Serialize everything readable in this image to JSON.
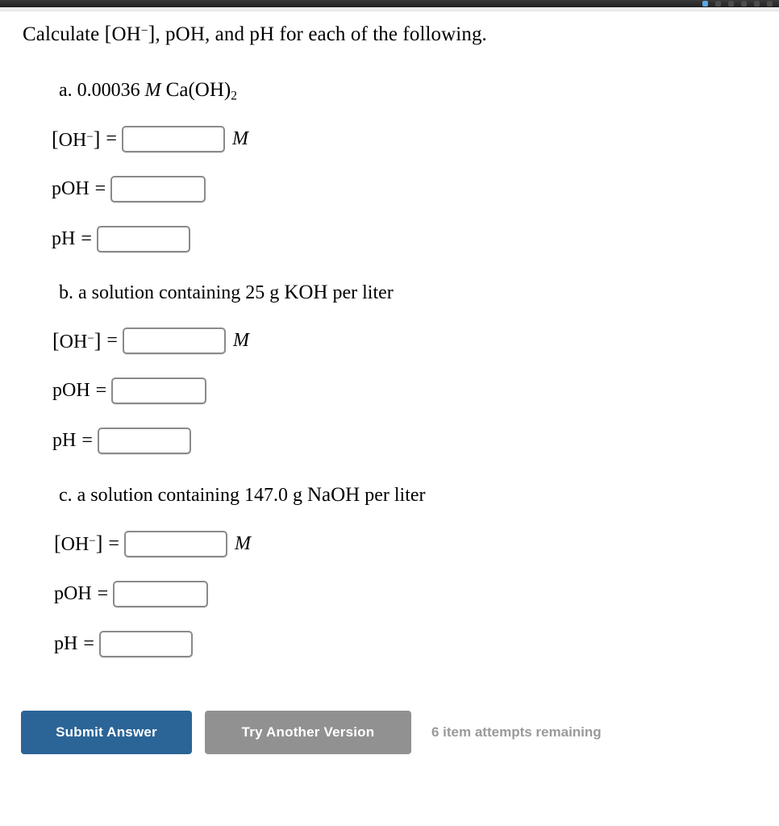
{
  "chrome": {
    "dots": [
      "chrome-dot",
      "chrome-dot",
      "chrome-dot",
      "chrome-dot",
      "chrome-dot"
    ],
    "accent_color": "#5aa9e6",
    "bar_color": "#2c2c2c"
  },
  "prompt": {
    "lead": "Calculate",
    "species_open": "[",
    "species": "OH",
    "species_charge": "−",
    "species_close": "]",
    "rest": ", pOH, and pH for each of the following."
  },
  "fields": {
    "oh_label_open": "[",
    "oh_label": "OH",
    "oh_label_charge": "−",
    "oh_label_close": "]",
    "poh_label": "pOH",
    "ph_label": "pH",
    "equals": "=",
    "unit": "M",
    "oh_value": "",
    "poh_value": "",
    "ph_value": "",
    "placeholder": ""
  },
  "parts": [
    {
      "id": "a",
      "marker": "a.",
      "stem_number": "0.00036",
      "stem_unit": "M",
      "stem_formula_main": "Ca",
      "stem_formula_group_open": "(",
      "stem_formula_group": "OH",
      "stem_formula_group_close": ")",
      "stem_formula_sub": "2",
      "stem_text": "",
      "stem_suffix": ""
    },
    {
      "id": "b",
      "marker": "b.",
      "stem_text": "a solution containing 25 g",
      "stem_formula": "KOH",
      "stem_suffix": "per liter"
    },
    {
      "id": "c",
      "marker": "c.",
      "stem_text": "a solution containing 147.0 g",
      "stem_formula": "NaOH",
      "stem_suffix": "per liter"
    }
  ],
  "actions": {
    "submit_label": "Submit Answer",
    "retry_label": "Try Another Version",
    "attempts_text": "6 item attempts remaining",
    "submit_color": "#2b6496",
    "retry_color": "#919191",
    "attempts_color": "#9a9a9a"
  }
}
